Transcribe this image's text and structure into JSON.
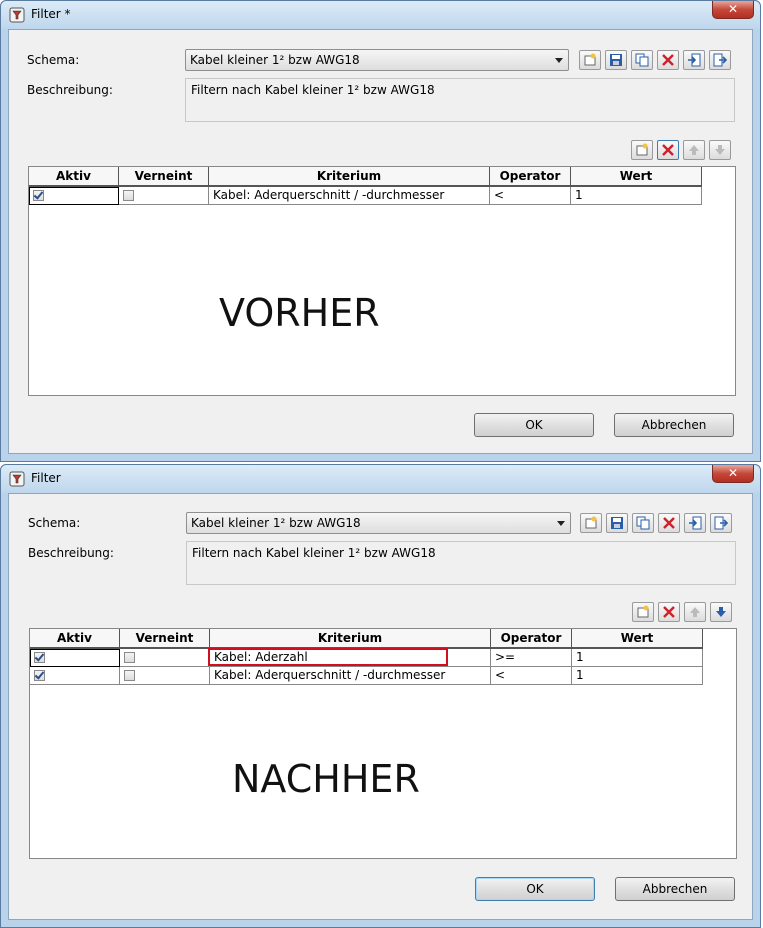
{
  "windows": [
    {
      "title": "Filter *",
      "schema_label": "Schema:",
      "schema_value": "Kabel kleiner 1² bzw AWG18",
      "description_label": "Beschreibung:",
      "description_value": "Filtern nach Kabel kleiner 1² bzw AWG18",
      "columns": [
        "Aktiv",
        "Verneint",
        "Kriterium",
        "Operator",
        "Wert"
      ],
      "rows": [
        {
          "aktiv": true,
          "verneint": false,
          "kriterium": "Kabel: Aderquerschnitt / -durchmesser",
          "operator": "<",
          "wert": "1"
        }
      ],
      "overlay_text": "VORHER",
      "ok_label": "OK",
      "cancel_label": "Abbrechen"
    },
    {
      "title": "Filter",
      "schema_label": "Schema:",
      "schema_value": "Kabel kleiner 1² bzw AWG18",
      "description_label": "Beschreibung:",
      "description_value": "Filtern nach Kabel kleiner 1² bzw AWG18",
      "columns": [
        "Aktiv",
        "Verneint",
        "Kriterium",
        "Operator",
        "Wert"
      ],
      "rows": [
        {
          "aktiv": true,
          "verneint": false,
          "kriterium": "Kabel: Aderzahl",
          "operator": ">=",
          "wert": "1"
        },
        {
          "aktiv": true,
          "verneint": false,
          "kriterium": "Kabel: Aderquerschnitt / -durchmesser",
          "operator": "<",
          "wert": "1"
        }
      ],
      "overlay_text": "NACHHER",
      "ok_label": "OK",
      "cancel_label": "Abbrechen"
    }
  ],
  "close_glyph": "✕",
  "colors": {
    "highlight": "#d01020",
    "accent": "#2b4f88"
  }
}
